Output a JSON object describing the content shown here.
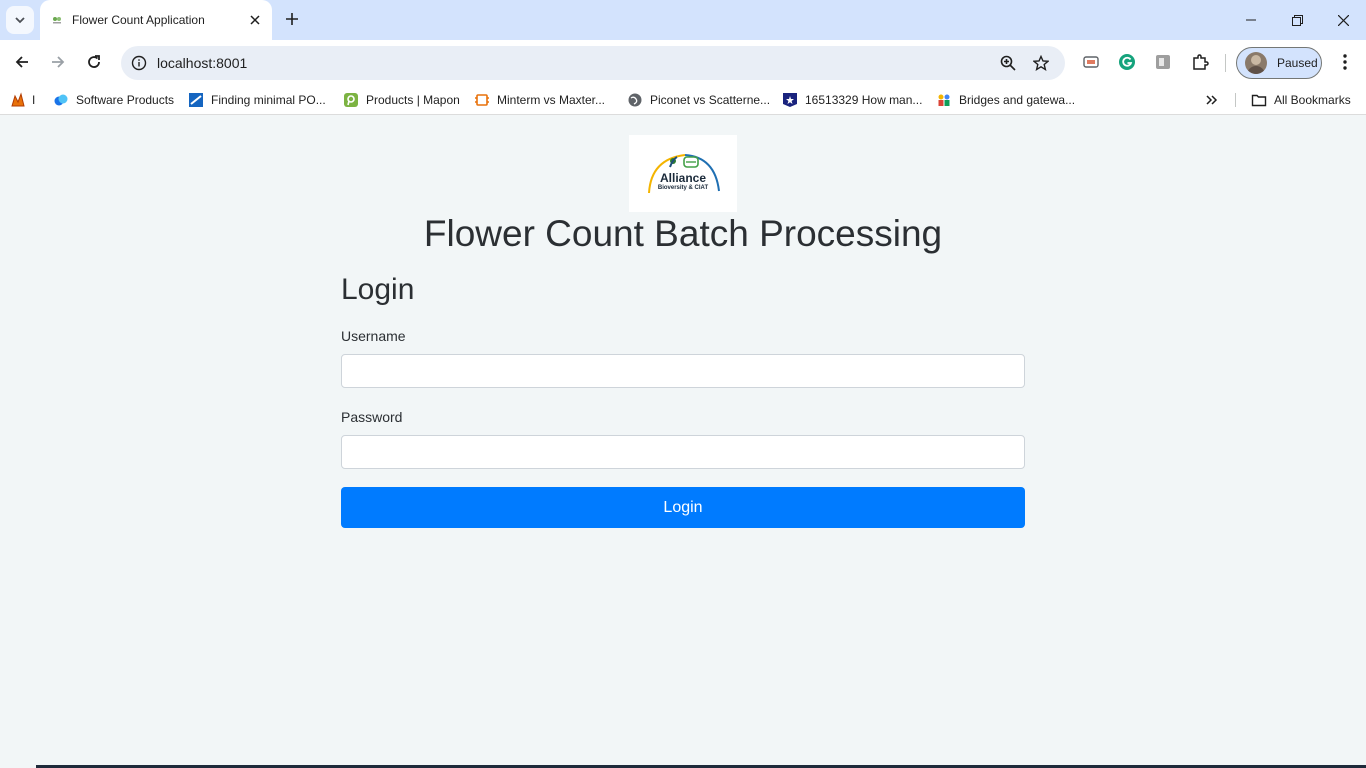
{
  "tab": {
    "title": "Flower Count Application"
  },
  "toolbar": {
    "url": "localhost:8001",
    "profile_label": "Paused"
  },
  "bookmarks": {
    "items": [
      {
        "label": "I"
      },
      {
        "label": "Software Products"
      },
      {
        "label": "Finding minimal PO..."
      },
      {
        "label": "Products | Mapon"
      },
      {
        "label": "Minterm vs Maxter..."
      },
      {
        "label": "Piconet vs Scatterne..."
      },
      {
        "label": "16513329 How man..."
      },
      {
        "label": "Bridges and gatewa..."
      }
    ],
    "all_bookmarks": "All Bookmarks"
  },
  "page": {
    "logo_name": "Alliance",
    "logo_sub": "Bioversity & CIAT",
    "title": "Flower Count Batch Processing",
    "login_heading": "Login",
    "username_label": "Username",
    "username_value": "",
    "password_label": "Password",
    "password_value": "",
    "login_button": "Login"
  },
  "colors": {
    "primary_button": "#007bff",
    "page_background": "#f2f6f7",
    "tabstrip": "#d3e3fd"
  }
}
